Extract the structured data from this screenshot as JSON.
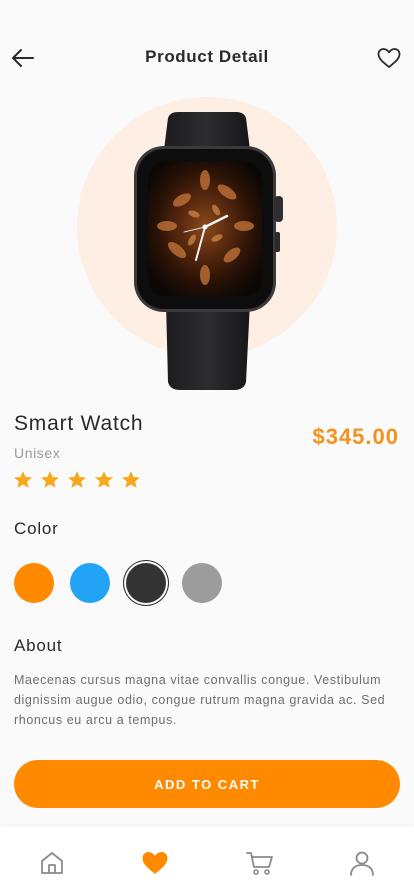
{
  "header": {
    "title": "Product Detail",
    "back_icon": "arrow-left-icon",
    "favorite_icon": "heart-outline-icon"
  },
  "product": {
    "name": "Smart Watch",
    "category": "Unisex",
    "price": "$345.00",
    "rating": 5,
    "rating_max": 5
  },
  "colors": {
    "label": "Color",
    "options": [
      {
        "hex": "#ff8a00",
        "selected": false
      },
      {
        "hex": "#22a3f5",
        "selected": false
      },
      {
        "hex": "#333333",
        "selected": true
      },
      {
        "hex": "#9c9c9c",
        "selected": false
      }
    ]
  },
  "about": {
    "label": "About",
    "text": "Maecenas cursus magna vitae convallis congue. Vestibulum dignissim augue odio, congue rutrum magna gravida ac. Sed rhoncus eu arcu a tempus."
  },
  "cta": {
    "label": "ADD TO CART"
  },
  "bottom_nav": {
    "items": [
      {
        "icon": "home-icon",
        "active": false
      },
      {
        "icon": "heart-icon",
        "active": true
      },
      {
        "icon": "cart-icon",
        "active": false
      },
      {
        "icon": "user-icon",
        "active": false
      }
    ]
  },
  "theme": {
    "accent": "#ff8a00",
    "price_color": "#f5911e",
    "hero_bg": "#ffeee3",
    "star_color": "#f7a81b"
  }
}
